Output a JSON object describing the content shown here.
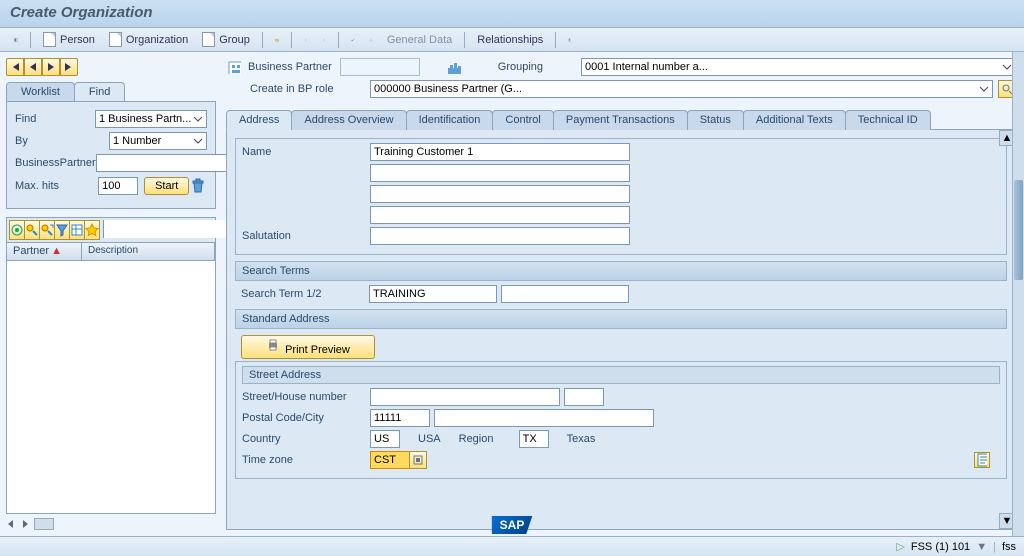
{
  "title": "Create Organization",
  "toolbar": {
    "person": "Person",
    "organization": "Organization",
    "group": "Group",
    "general_data": "General Data",
    "relationships": "Relationships"
  },
  "bp_header": {
    "label": "Business Partner",
    "grouping_label": "Grouping",
    "grouping_value": "0001 Internal number a...",
    "role_label": "Create in BP role",
    "role_value": "000000 Business Partner (G..."
  },
  "side_tabs": {
    "worklist": "Worklist",
    "find": "Find"
  },
  "search": {
    "find_label": "Find",
    "find_value": "1 Business Partn...",
    "by_label": "By",
    "by_value": "1 Number",
    "bp_label": "BusinessPartner",
    "maxhits_label": "Max. hits",
    "maxhits_value": "100",
    "start": "Start"
  },
  "grid": {
    "col1": "Partner",
    "col2": "Description"
  },
  "main_tabs": [
    "Address",
    "Address Overview",
    "Identification",
    "Control",
    "Payment Transactions",
    "Status",
    "Additional Texts",
    "Technical ID"
  ],
  "address": {
    "name_label": "Name",
    "name_value": "Training Customer 1",
    "salutation_label": "Salutation",
    "search_terms_header": "Search Terms",
    "search_term_label": "Search Term 1/2",
    "search_term_value": "TRAINING",
    "standard_address_header": "Standard Address",
    "print_preview": "Print Preview",
    "street_address_header": "Street Address",
    "street_label": "Street/House number",
    "postal_label": "Postal Code/City",
    "postal_value": "11111",
    "country_label": "Country",
    "country_code": "US",
    "country_name": "USA",
    "region_label": "Region",
    "region_code": "TX",
    "region_name": "Texas",
    "timezone_label": "Time zone",
    "timezone_value": "CST"
  },
  "status": {
    "system": "FSS (1) 101",
    "server": "fss"
  }
}
